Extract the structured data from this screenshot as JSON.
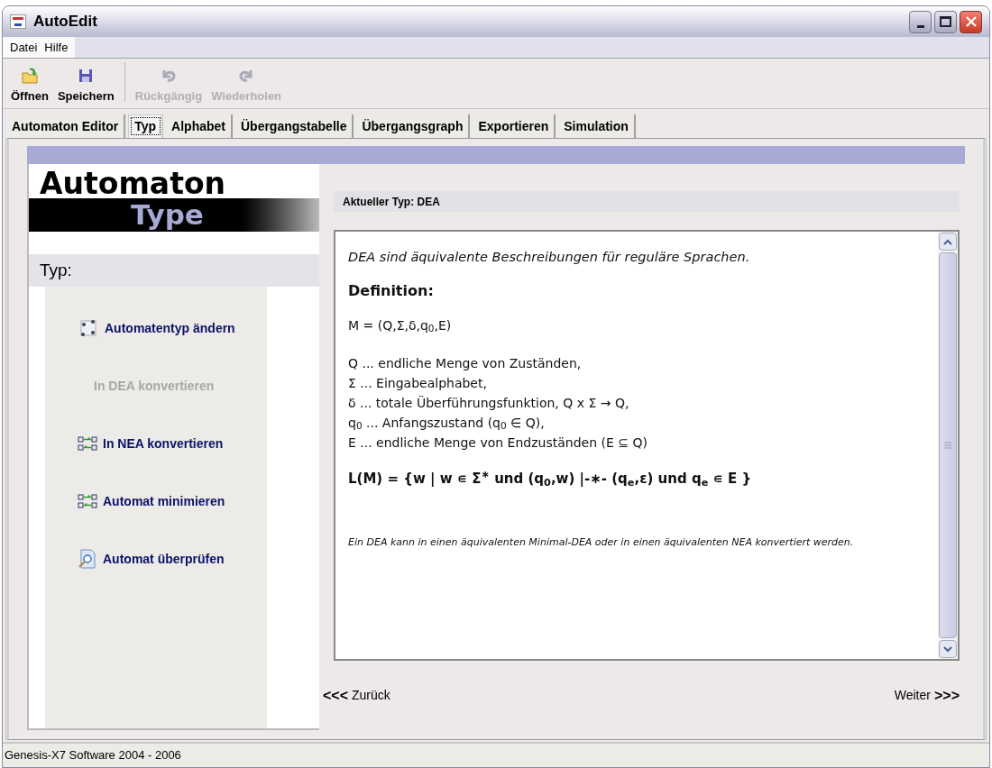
{
  "window": {
    "title": "AutoEdit"
  },
  "menu": [
    "Datei",
    "Hilfe"
  ],
  "toolbar": [
    {
      "label": "Öffnen",
      "kind": "open",
      "disabled": false
    },
    {
      "label": "Speichern",
      "kind": "save",
      "disabled": false
    },
    {
      "label": "Rückgängig",
      "kind": "undo",
      "disabled": true
    },
    {
      "label": "Wiederholen",
      "kind": "redo",
      "disabled": true
    }
  ],
  "tabs": [
    {
      "label": "Automaton Editor",
      "selected": false
    },
    {
      "label": "Typ",
      "selected": true
    },
    {
      "label": "Alphabet",
      "selected": false
    },
    {
      "label": "Übergangstabelle",
      "selected": false
    },
    {
      "label": "Übergangsgraph",
      "selected": false
    },
    {
      "label": "Exportieren",
      "selected": false
    },
    {
      "label": "Simulation",
      "selected": false
    }
  ],
  "banner": {
    "line_1": "Automaton",
    "line_2": "Type"
  },
  "sidebar": {
    "heading": "Typ:",
    "items": [
      {
        "label": "Automatentyp ändern",
        "kind": "graph",
        "disabled": false
      },
      {
        "label": "In DEA konvertieren",
        "kind": "none",
        "disabled": true
      },
      {
        "label": "In NEA konvertieren",
        "kind": "convert",
        "disabled": false
      },
      {
        "label": "Automat minimieren",
        "kind": "convert",
        "disabled": false
      },
      {
        "label": "Automat überprüfen",
        "kind": "check",
        "disabled": false
      }
    ]
  },
  "current_type": "Aktueller Typ: DEA",
  "content": [
    {
      "kind": "intro",
      "text": "DEA sind äquivalente Beschreibungen für reguläre Sprachen."
    },
    {
      "kind": "heading",
      "text": "Definition:"
    },
    {
      "kind": "formula",
      "text": "M = (Q,Σ,δ,q$_{0}$,E)"
    },
    {
      "kind": "list",
      "lines": [
        "Q ... endliche Menge von Zuständen,",
        "Σ ... Eingabealphabet,",
        "δ ... totale Überführungsfunktion, Q x Σ → Q,",
        "q$_{0}$ ... Anfangszustand (q$_{0}$ ∈ Q),",
        "E ... endliche Menge von Endzuständen (E ⊆ Q)"
      ]
    },
    {
      "kind": "language",
      "text": "L(M) = {w | w ∊ Σ$^{∗}$ und (q$_{0}$,w) |-∗- (q$_{e}$,ε) und q$_{e}$ ∊ E }"
    },
    {
      "kind": "note",
      "text": "Ein DEA kann in einen äquivalenten Minimal-DEA oder in einen äquivalenten NEA konvertiert werden."
    }
  ],
  "nav": {
    "back_arrows": "<<<",
    "back": "Zurück",
    "next": "Weiter",
    "next_arrows": ">>>"
  },
  "status_bar": "Genesis-X7 Software 2004 - 2006"
}
